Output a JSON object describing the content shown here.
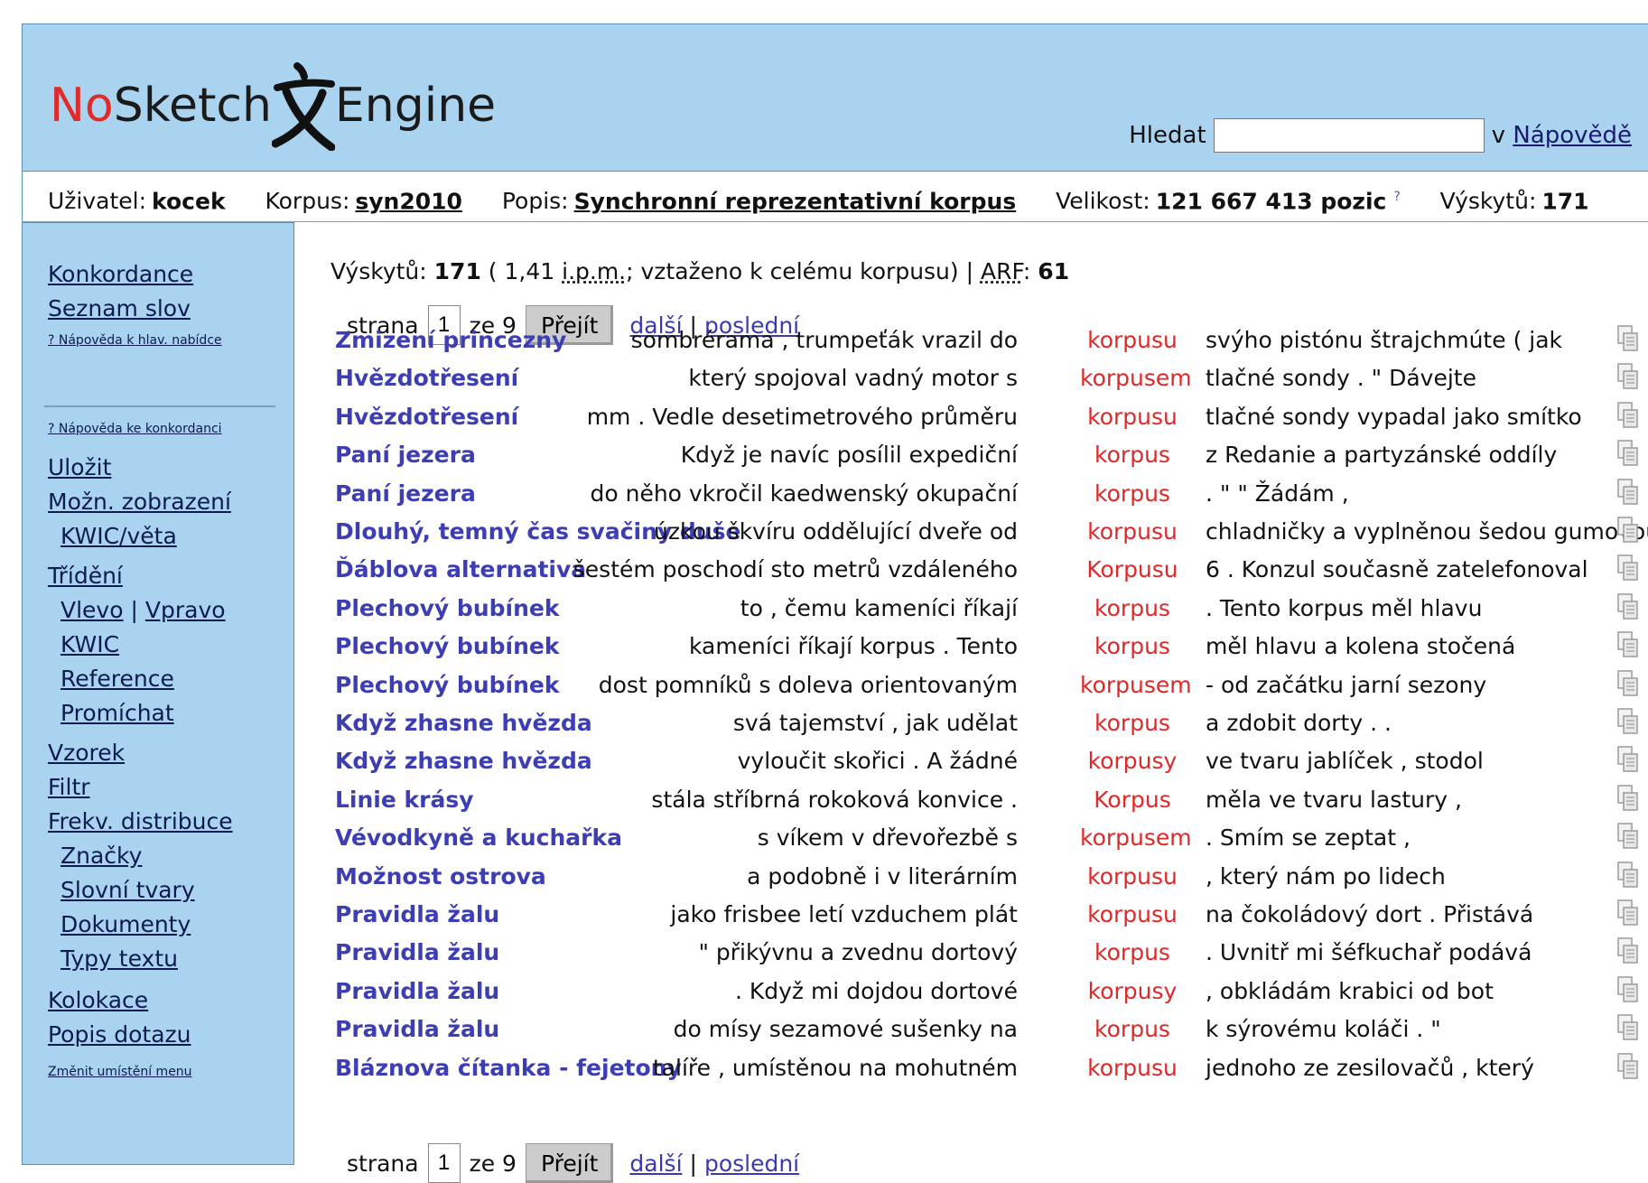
{
  "header": {
    "logo_no": "No",
    "logo_sketch": "Sketch",
    "logo_engine": "Engine",
    "search_label": "Hledat",
    "search_value": "",
    "search_in": "v",
    "search_help_link": "Nápovědě"
  },
  "infobar": {
    "user_label": "Uživatel:",
    "user": "kocek",
    "corpus_label": "Korpus:",
    "corpus": "syn2010",
    "desc_label": "Popis:",
    "desc": "Synchronní reprezentativní korpus",
    "size_label": "Velikost:",
    "size": "121 667 413 pozic",
    "size_help": "?",
    "hits_label": "Výskytů:",
    "hits": "171"
  },
  "sidebar": {
    "items": [
      {
        "label": "Konkordance"
      },
      {
        "label": "Seznam slov"
      },
      {
        "label": "? Nápověda k hlav. nabídce"
      },
      {
        "label": "? Nápověda ke konkordanci"
      },
      {
        "label": "Uložit"
      },
      {
        "label": "Možn. zobrazení"
      },
      {
        "label": "KWIC/věta"
      },
      {
        "label": "Třídění"
      },
      {
        "label": "Vlevo"
      },
      {
        "label": "Vpravo"
      },
      {
        "label": "KWIC"
      },
      {
        "label": "Reference"
      },
      {
        "label": "Promíchat"
      },
      {
        "label": "Vzorek"
      },
      {
        "label": "Filtr"
      },
      {
        "label": "Frekv. distribuce"
      },
      {
        "label": "Značky"
      },
      {
        "label": "Slovní tvary"
      },
      {
        "label": "Dokumenty"
      },
      {
        "label": "Typy textu"
      },
      {
        "label": "Kolokace"
      },
      {
        "label": "Popis dotazu"
      },
      {
        "label": "Změnit umístění menu"
      }
    ],
    "sort_separator": "|"
  },
  "summary": {
    "hits_label": "Výskytů:",
    "hits": "171",
    "ipm_open": "( 1,41",
    "ipm_abbr": "i.p.m.",
    "ipm_rest": "; vztaženo k celému korpusu) |",
    "arf_label": "ARF",
    "arf_colon": ":",
    "arf": "61"
  },
  "pager": {
    "page_label": "strana",
    "page_value": "1",
    "of_label": "ze 9",
    "go_label": "Přejít",
    "next_label": "další",
    "separator": "|",
    "last_label": "poslední"
  },
  "concordance": [
    {
      "ref": "Zmizení princezny",
      "left": "sombrérama , trumpeťák vrazil do",
      "kwic": "korpusu",
      "right": "svýho pistónu štrajchmúte ( jak"
    },
    {
      "ref": "Hvězdotřesení",
      "left": "který spojoval vadný motor s",
      "kwic": "korpusem",
      "right": "tlačné sondy . \" Dávejte"
    },
    {
      "ref": "Hvězdotřesení",
      "left": "mm . Vedle desetimetrového průměru",
      "kwic": "korpusu",
      "right": "tlačné sondy vypadal jako smítko"
    },
    {
      "ref": "Paní jezera",
      "left": "Když je navíc posílil expediční",
      "kwic": "korpus",
      "right": "z Redanie a partyzánské oddíly"
    },
    {
      "ref": "Paní jezera",
      "left": "do něho vkročil kaedwenský okupační",
      "kwic": "korpus",
      "right": ". \" \" Žádám ,"
    },
    {
      "ref": "Dlouhý, temný čas svačiny duše",
      "left": "úzkou škvíru oddělující dveře od",
      "kwic": "korpusu",
      "right": "chladničky a vyplněnou šedou gumovou"
    },
    {
      "ref": "Ďáblova alternativa",
      "left": "šestém poschodí sto metrů vzdáleného",
      "kwic": "Korpusu",
      "right": "6 . Konzul současně zatelefonoval"
    },
    {
      "ref": "Plechový bubínek",
      "left": "to , čemu kameníci říkají",
      "kwic": "korpus",
      "right": ". Tento korpus měl hlavu"
    },
    {
      "ref": "Plechový bubínek",
      "left": "kameníci říkají korpus . Tento",
      "kwic": "korpus",
      "right": "měl hlavu a kolena stočená"
    },
    {
      "ref": "Plechový bubínek",
      "left": "dost pomníků s doleva orientovaným",
      "kwic": "korpusem",
      "right": "- od začátku jarní sezony"
    },
    {
      "ref": "Když zhasne hvězda",
      "left": "svá tajemství , jak udělat",
      "kwic": "korpus",
      "right": "a zdobit dorty . ."
    },
    {
      "ref": "Když zhasne hvězda",
      "left": "vyloučit skořici . A žádné",
      "kwic": "korpusy",
      "right": "ve tvaru jablíček , stodol"
    },
    {
      "ref": "Linie krásy",
      "left": "stála stříbrná rokoková konvice .",
      "kwic": "Korpus",
      "right": "měla ve tvaru lastury ,"
    },
    {
      "ref": "Vévodkyně a kuchařka",
      "left": "s víkem v dřevořezbě s",
      "kwic": "korpusem",
      "right": ". Smím se zeptat ,"
    },
    {
      "ref": "Možnost ostrova",
      "left": "a podobně i v literárním",
      "kwic": "korpusu",
      "right": ", který nám po lidech"
    },
    {
      "ref": "Pravidla žalu",
      "left": "jako frisbee letí vzduchem plát",
      "kwic": "korpusu",
      "right": "na čokoládový dort . Přistává"
    },
    {
      "ref": "Pravidla žalu",
      "left": "\" přikývnu a zvednu dortový",
      "kwic": "korpus",
      "right": ". Uvnitř mi šéfkuchař podává"
    },
    {
      "ref": "Pravidla žalu",
      "left": ". Když mi dojdou dortové",
      "kwic": "korpusy",
      "right": ", obkládám krabici od bot"
    },
    {
      "ref": "Pravidla žalu",
      "left": "do mísy sezamové sušenky na",
      "kwic": "korpus",
      "right": "k sýrovému koláči . \""
    },
    {
      "ref": "Bláznova čítanka - fejetony",
      "left": "talíře , umístěnou na mohutném",
      "kwic": "korpusu",
      "right": "jednoho ze zesilovačů , který"
    }
  ],
  "colors": {
    "header_bg": "#a9d3ef",
    "kwic": "#e02828",
    "ref": "#3d3db4",
    "logo_red": "#e02b2b"
  }
}
